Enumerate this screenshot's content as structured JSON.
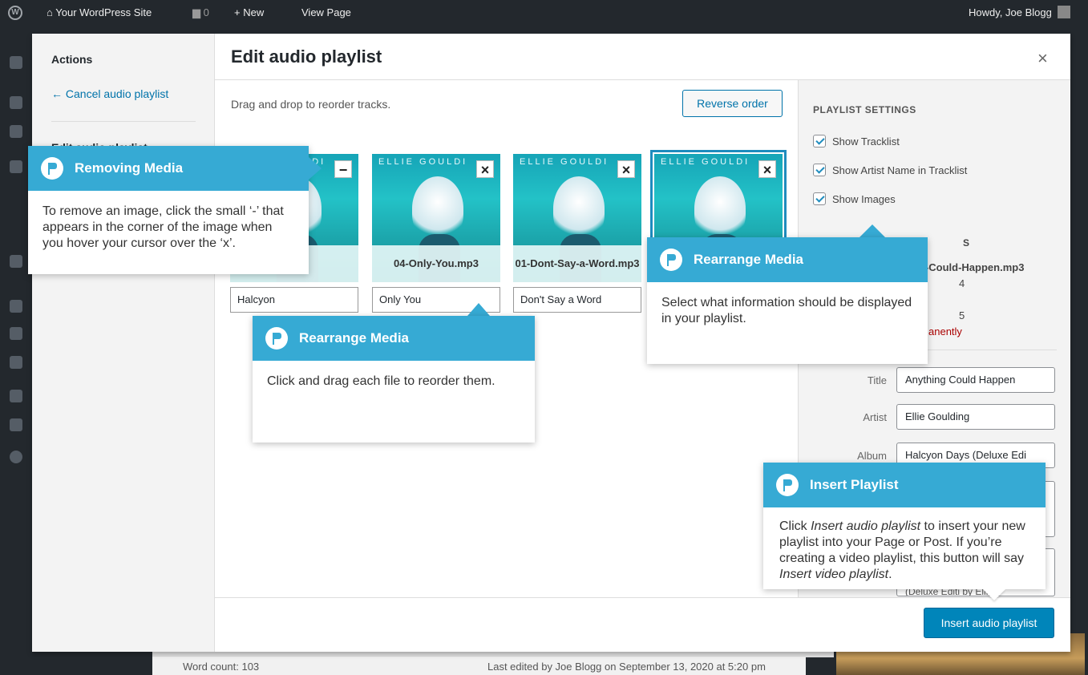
{
  "adminbar": {
    "site_name": "Your WordPress Site",
    "comments_count": "0",
    "new_label": "New",
    "view_page": "View Page",
    "howdy": "Howdy, Joe Blogg"
  },
  "background_editor": {
    "word_count": "Word count: 103",
    "last_edited": "Last edited by Joe Blogg on September 13, 2020 at 5:20 pm"
  },
  "modal": {
    "sidebar_heading": "Actions",
    "cancel_link": "← Cancel audio playlist",
    "sidebar_partial": "Edit audio playlist",
    "title": "Edit audio playlist",
    "close_symbol": "×",
    "instructions": "Drag and drop to reorder tracks.",
    "reverse_button": "Reverse order",
    "tracks": [
      {
        "file": ".mp3",
        "title": "Halcyon",
        "artist_art": "ELLIE GOULDI"
      },
      {
        "file": "04-Only-You.mp3",
        "title": "Only You",
        "artist_art": "ELLIE GOULDI"
      },
      {
        "file": "01-Dont-Say-a-Word.mp3",
        "title": "Don't Say a Word",
        "artist_art": "ELLIE GOULDI"
      },
      {
        "file": "",
        "title": "",
        "artist_art": "ELLIE GOULDI"
      }
    ],
    "settings_heading": "PLAYLIST SETTINGS",
    "show_tracklist": "Show Tracklist",
    "show_artist": "Show Artist Name in Tracklist",
    "show_images": "Show Images",
    "details_partial_heading": "S",
    "details_file": "g-Could-Happen.mp3",
    "details_line2": "4",
    "details_line3": "5",
    "details_delete": "anently",
    "field_title_label": "Title",
    "field_title_value": "Anything Could Happen",
    "field_artist_label": "Artist",
    "field_artist_value": "Ellie Goulding",
    "field_album_label": "Album",
    "field_album_value": "Halcyon Days (Deluxe Edi",
    "field_description_partial": "(Deluxe Editi    by Ellie",
    "insert_button": "Insert audio playlist"
  },
  "callouts": {
    "removing": {
      "title": "Removing Media",
      "text": "To remove an image, click the small ‘-’ that appears in the corner of the image when you hover your cursor over the ‘x’."
    },
    "rearrange1": {
      "title": "Rearrange Media",
      "text": "Click and drag each file to reorder them."
    },
    "rearrange2": {
      "title": "Rearrange Media",
      "text": "Select what information should be displayed in your playlist."
    },
    "insert": {
      "title": "Insert Playlist",
      "text_part1": "Click ",
      "text_em1": "Insert audio playlist",
      "text_part2": " to insert your new playlist into your Page or Post. If you’re creating a video playlist, this button will say ",
      "text_em2": "Insert video playlist",
      "text_part3": "."
    }
  },
  "colors": {
    "accent": "#36aad4",
    "primary_button": "#0085ba",
    "link": "#0073aa",
    "delete": "#aa0000"
  }
}
